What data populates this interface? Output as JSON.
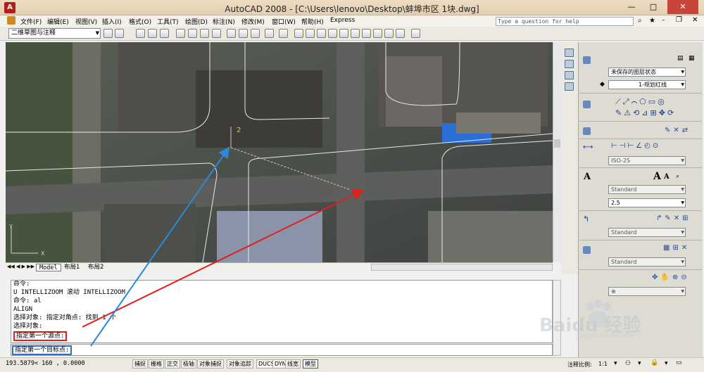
{
  "window": {
    "title": "AutoCAD 2008 - [C:\\Users\\lenovo\\Desktop\\蚌埠市区 1块.dwg]",
    "minimize": "—",
    "maximize": "□",
    "close": "✕"
  },
  "menu": {
    "items": [
      "文件(F)",
      "编辑(E)",
      "视图(V)",
      "插入(I)",
      "格式(O)",
      "工具(T)",
      "绘图(D)",
      "标注(N)",
      "修改(M)",
      "窗口(W)",
      "帮助(H)",
      "Express"
    ],
    "help_placeholder": "Type a question for help"
  },
  "toolbar": {
    "workspace": "二维草图与注释"
  },
  "drawing": {
    "point_label_1": "1",
    "point_label_2": "2",
    "ucs_y": "Y",
    "ucs_x": "X"
  },
  "layout_tabs": [
    "Model",
    "布局1",
    "布局2"
  ],
  "command": {
    "lines": [
      "命令:",
      "U INTELLIZOOM 滚动 INTELLIZOOM",
      "命令: al",
      "ALIGN",
      "选择对象: 指定对角点: 找到 1 个",
      "选择对象:",
      "指定第一个源点:"
    ],
    "prompt": "指定第一个目标点:"
  },
  "status": {
    "coordinates": "193.5879<   160      , 0.0000",
    "toggles": [
      "捕捉",
      "栅格",
      "正交",
      "极轴",
      "对象捕捉",
      "对象追踪",
      "DUCS",
      "DYN",
      "线宽",
      "模型"
    ],
    "scale_label": "注释比例:",
    "scale_value": "1:1"
  },
  "panel": {
    "layer_state": "未保存的图层状态",
    "current_layer": "1-规划红线",
    "dim_style": "ISO-25",
    "text_style": "Standard",
    "text_height": "2.5",
    "table_style": "Standard",
    "mleader_style": "Standard"
  },
  "watermark": {
    "brand": "Baidu 经验",
    "url": "jingyan.baidu.com"
  },
  "colors": {
    "arrow_red": "#e0201a",
    "arrow_blue": "#2a8ad8",
    "highlight_red": "#e0201a",
    "highlight_blue": "#2a6fd8",
    "title_bar": "#e6d3b4"
  }
}
